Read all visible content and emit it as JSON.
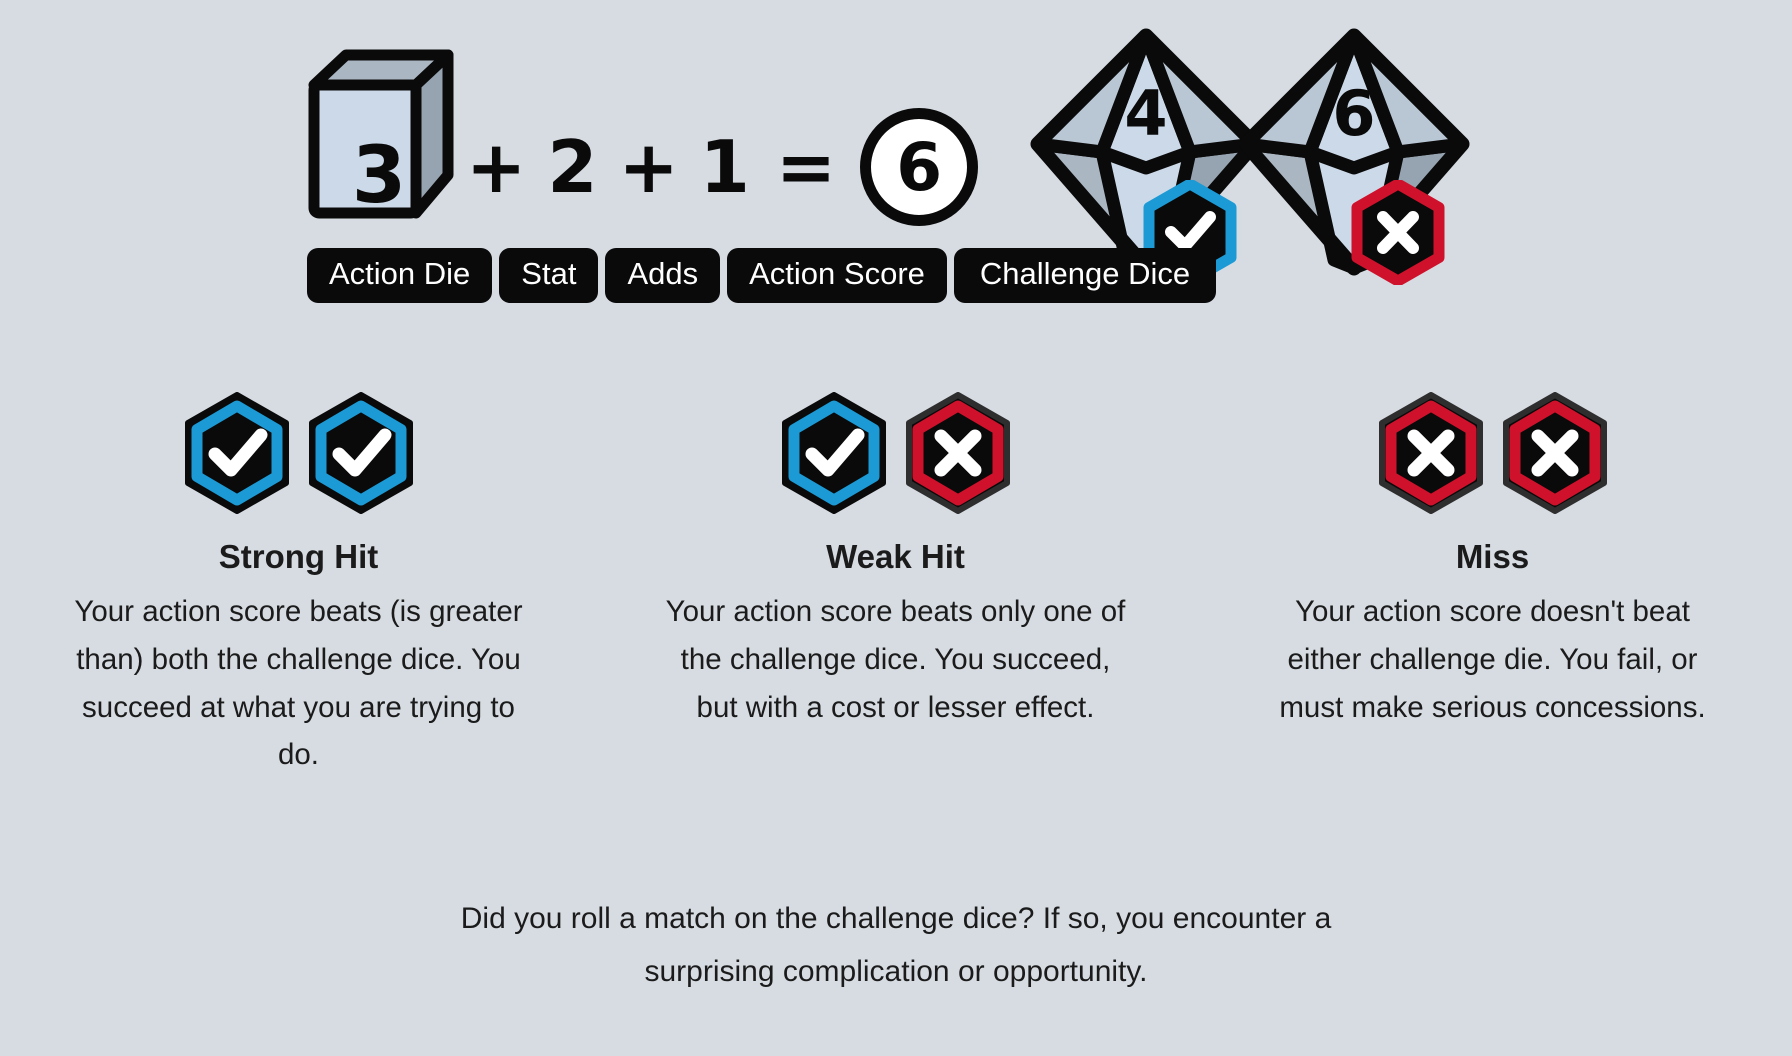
{
  "theme": {
    "background": "#d6dce2",
    "ink": "#1b1b1b",
    "black": "#0a0a0a",
    "blue": "#1b9ad6",
    "red": "#d0112b",
    "miss_outer": "#2e2e2e",
    "die_face_light": "#ccd9e8",
    "die_face_mid": "#aab6c2",
    "die_face_dark": "#96a3b0",
    "white": "#ffffff"
  },
  "formula": {
    "action_die": {
      "value": "3",
      "icon": "cube-die-icon"
    },
    "op1": "+",
    "stat": "2",
    "op2": "+",
    "adds": "1",
    "equals": "=",
    "action_score": "6",
    "challenge_dice": [
      {
        "value": "4",
        "badge": "check-hexagon-icon",
        "badge_color": "#1b9ad6"
      },
      {
        "value": "6",
        "badge": "x-hexagon-icon",
        "badge_color": "#d0112b"
      }
    ],
    "labels": [
      {
        "name": "action-die",
        "text": "Action Die"
      },
      {
        "name": "stat",
        "text": "Stat"
      },
      {
        "name": "adds",
        "text": "Adds"
      },
      {
        "name": "action-score",
        "text": "Action Score"
      },
      {
        "name": "challenge-dice",
        "text": "Challenge Dice"
      }
    ]
  },
  "outcomes": [
    {
      "id": "strong-hit",
      "title": "Strong Hit",
      "description": "Your action score beats (is greater than) both the challenge dice. You succeed at what you are trying to do.",
      "hexes": [
        {
          "glyph": "check",
          "ring": "#1b9ad6",
          "outer": "#0a0a0a"
        },
        {
          "glyph": "check",
          "ring": "#1b9ad6",
          "outer": "#0a0a0a"
        }
      ]
    },
    {
      "id": "weak-hit",
      "title": "Weak Hit",
      "description": "Your action score beats only one of the challenge dice. You succeed, but with a cost or lesser effect.",
      "hexes": [
        {
          "glyph": "check",
          "ring": "#1b9ad6",
          "outer": "#0a0a0a"
        },
        {
          "glyph": "x",
          "ring": "#d0112b",
          "outer": "#2e2e2e"
        }
      ]
    },
    {
      "id": "miss",
      "title": "Miss",
      "description": "Your action score doesn't beat either challenge die. You fail, or must make serious concessions.",
      "hexes": [
        {
          "glyph": "x",
          "ring": "#d0112b",
          "outer": "#2e2e2e"
        },
        {
          "glyph": "x",
          "ring": "#d0112b",
          "outer": "#2e2e2e"
        }
      ]
    }
  ],
  "footer": {
    "line1": "Did you roll a match on the challenge dice? If so, you encounter a",
    "line2": "surprising complication or opportunity."
  }
}
